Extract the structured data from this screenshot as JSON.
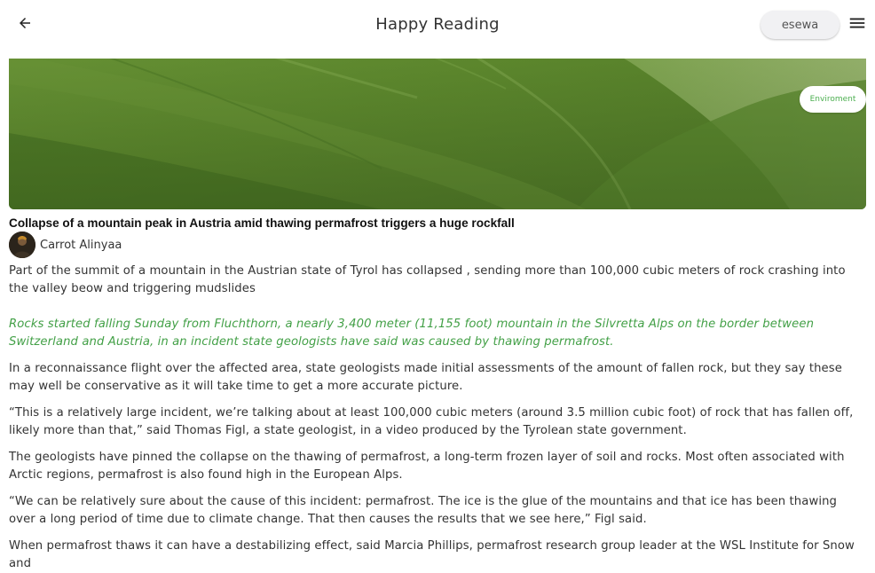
{
  "appbar": {
    "title": "Happy Reading",
    "back_icon": "arrow-left-icon",
    "wallet_button_label": "esewa",
    "menu_icon": "hamburger-menu-icon"
  },
  "article": {
    "category": "Enviroment",
    "headline": "Collapse of a mountain peak in Austria amid thawing permafrost triggers a huge rockfall",
    "author": "Carrot Alinyaa",
    "summary": "Part of the summit of a mountain in the Austrian state of Tyrol has collapsed , sending more than 100,000 cubic meters of rock crashing into the valley beow and triggering mudslides",
    "highlight": "Rocks started falling Sunday from Fluchthorn, a nearly 3,400 meter (11,155 foot) mountain in the Silvretta Alps on the border between Switzerland and Austria, in an incident state geologists have said was caused by thawing permafrost.",
    "paragraphs": [
      "In a reconnaissance flight over the affected area, state geologists made initial assessments of the amount of fallen rock, but they say these may well be conservative as it will take time to get a more accurate picture.",
      "“This is a relatively large incident, we’re talking about at least 100,000 cubic meters (around 3.5 million cubic foot) of rock that has fallen off, likely more than that,” said Thomas Figl, a state geologist, in a video produced by the Tyrolean state government.",
      "The geologists have pinned the collapse on the thawing of permafrost, a long-term frozen layer of soil and rocks. Most often associated with Arctic regions, permafrost is also found high in the European Alps.",
      "“We can be relatively sure about the cause of this incident: permafrost. The ice is the glue of the mountains and that ice has been thawing over a long period of time due to climate change. That then causes the results that we see here,” Figl said.",
      "When permafrost thaws it can have a destabilizing effect, said Marcia Phillips, permafrost research group leader at the WSL Institute for Snow and"
    ]
  },
  "colors": {
    "accent_green": "#43a047",
    "chip_text": "#4caf50"
  }
}
